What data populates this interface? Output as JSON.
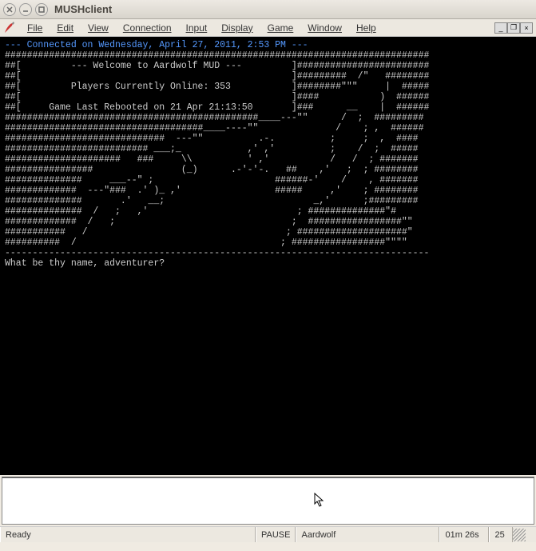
{
  "window": {
    "title": "MUSHclient"
  },
  "menu": {
    "file": "File",
    "edit": "Edit",
    "view": "View",
    "connection": "Connection",
    "input": "Input",
    "display": "Display",
    "game": "Game",
    "window": "Window",
    "help": "Help"
  },
  "terminal": {
    "connected": "--- Connected on Wednesday, April 27, 2011, 2:53 PM ---",
    "art": "#############################################################################\n##[         --- Welcome to Aardwolf MUD ---         ]########################\n##[                                                 ]#########  /\"   ########\n##[         Players Currently Online: 353           ]########\"\"\"     |  #####\n##[                                                 ]####           )  ######\n##[     Game Last Rebooted on 21 Apr 21:13:50       ]###      __    |  ######\n##############################################____---\"\"      /  ;  #########\n####################################____----\"\"              /    ; ,  ######\n#############################  ---\"\"          .-.          ;     ;  ,  ####\n########################## ___;_            ,' ,'          ;    /  ;  #####\n#####################   ###     \\\\          ' ,'           /   /  ; #######\n################                (_)      .-'-'-.   ##    ,'   ;  ; ########\n##############     ___--\" ;                      ######-'    /    , #######\n#############  ---\"###  .' )_ ,'                 #####     ,'    ; ########\n##############       .'   __;                           _,'      ;#########\n##############  /   ;   ,'                           ; ##############\"#\n#############  /   ;                                ;  #################\"\"\n###########   /                                    ; ####################\"\n##########  /                                     ; #################\"\"\"\"\n-----------------------------------------------------------------------------",
    "prompt": "What be thy name, adventurer?"
  },
  "input": {
    "value": "",
    "placeholder": ""
  },
  "status": {
    "ready": "Ready",
    "pause": "PAUSE",
    "world": "Aardwolf",
    "time": "01m 26s",
    "lines": "25"
  }
}
